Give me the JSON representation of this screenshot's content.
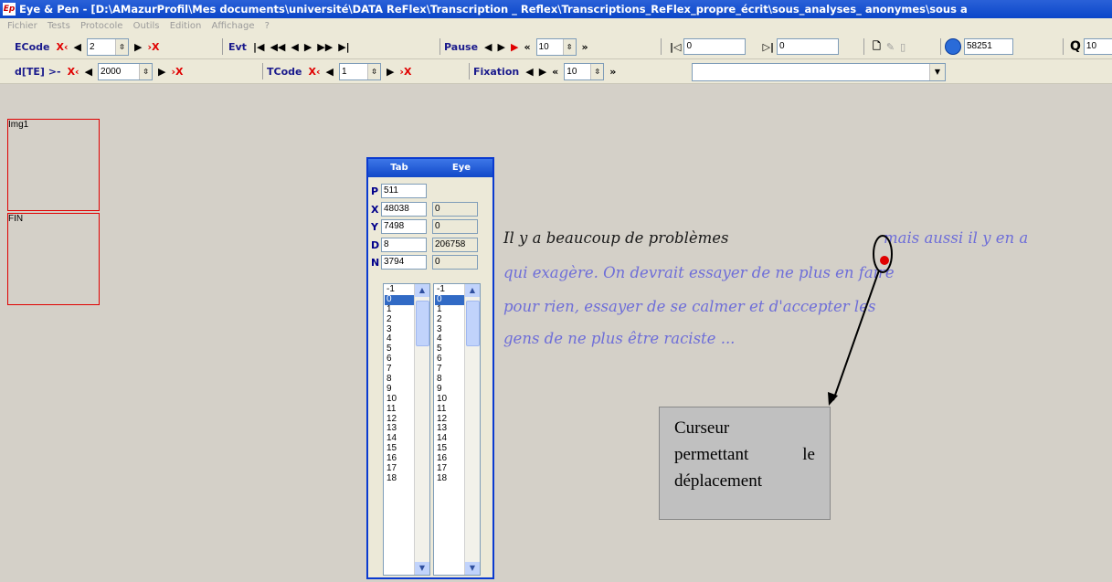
{
  "window": {
    "app_icon": "Ep",
    "title": "Eye & Pen - [D:\\AMazurProfil\\Mes documents\\université\\DATA ReFlex\\Transcription _ Reflex\\Transcriptions_ReFlex_propre_écrit\\sous_analyses_ anonymes\\sous a"
  },
  "menu": [
    "Fichier",
    "Tests",
    "Protocole",
    "Outils",
    "Edition",
    "Affichage",
    "?"
  ],
  "toolbar1": {
    "ecode_label": "ECode",
    "ecode_value": "2",
    "evt_label": "Evt",
    "pause_label": "Pause",
    "pause_value": "10",
    "start_value": "0",
    "end_value": "0",
    "clock_value": "58251",
    "zoom_value": "10"
  },
  "toolbar2": {
    "dte_label": "d[TE] >-",
    "dte_value": "2000",
    "tcode_label": "TCode",
    "tcode_value": "1",
    "fixation_label": "Fixation",
    "fixation_value": "10",
    "combo_value": ""
  },
  "images": [
    {
      "label": "Img1"
    },
    {
      "label": "FIN"
    }
  ],
  "panel": {
    "col_tab": "Tab",
    "col_eye": "Eye",
    "p": {
      "key": "P",
      "tab": "511"
    },
    "x": {
      "key": "X",
      "tab": "48038",
      "eye": "0"
    },
    "y": {
      "key": "Y",
      "tab": "7498",
      "eye": "0"
    },
    "d": {
      "key": "D",
      "tab": "8",
      "eye": "206758"
    },
    "n": {
      "key": "N",
      "tab": "3794",
      "eye": "0"
    },
    "list_items": [
      "-1",
      "0",
      "1",
      "2",
      "3",
      "4",
      "5",
      "6",
      "7",
      "8",
      "9",
      "10",
      "11",
      "12",
      "13",
      "14",
      "15",
      "16",
      "17",
      "18"
    ],
    "selected_item": "0"
  },
  "handwriting": {
    "line1_black": "Il y a beaucoup de problèmes",
    "line1_blue": "mais aussi il y en a",
    "line2": "qui exagère. On devrait essayer de ne plus en faire",
    "line3": "pour rien, essayer de se calmer et d'accepter les",
    "line4": "gens de ne plus être raciste ..."
  },
  "callout": {
    "line1": "Curseur",
    "line2": "permettant le",
    "line3": "déplacement"
  },
  "colors": {
    "title_bar": "#0b46c9",
    "panel_border": "#0a3ad0",
    "image_border": "#e00000",
    "handwriting_blue": "#6e6ed8",
    "cursor_red": "#e00000"
  }
}
